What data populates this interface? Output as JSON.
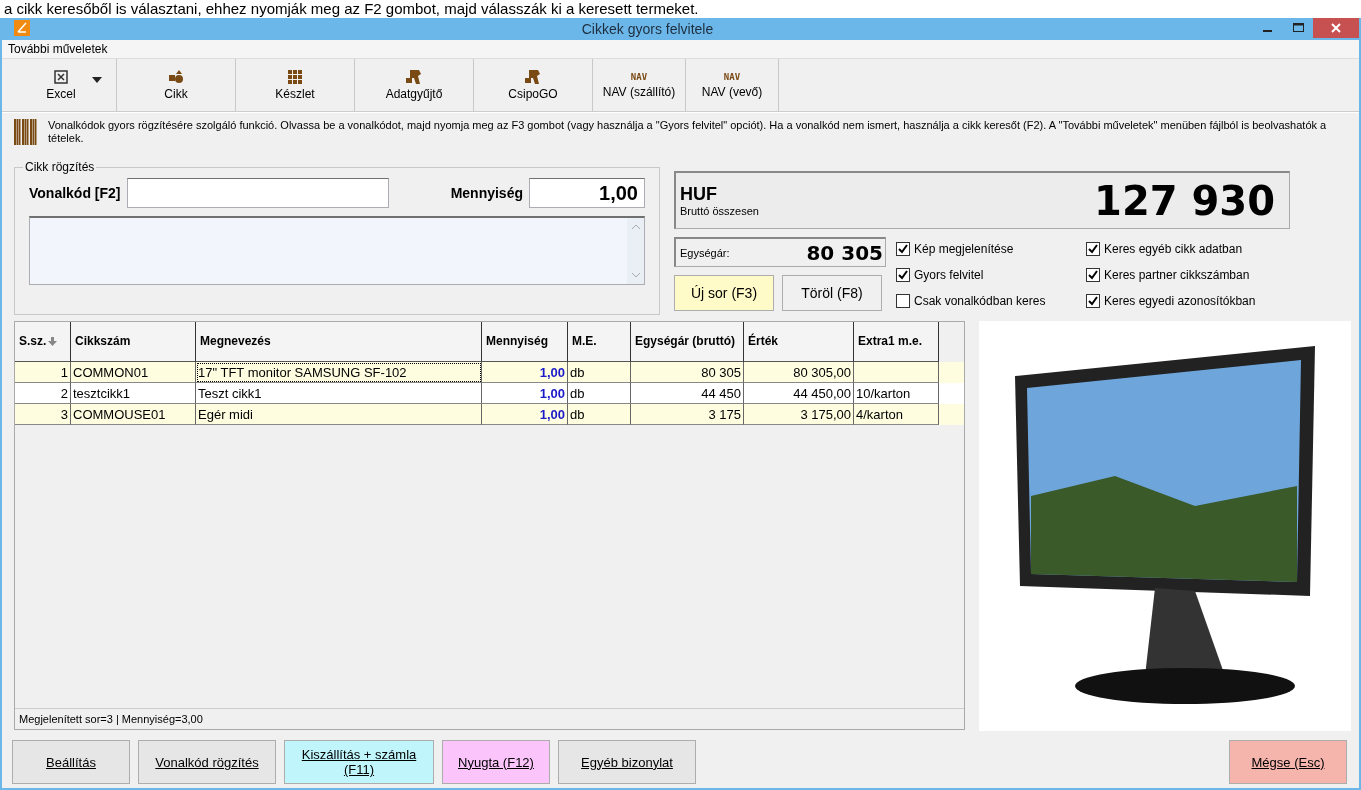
{
  "page_caption": "a cikk keresőből is választani, ehhez nyomják meg az F2 gombot, majd válasszák ki a keresett termeket.",
  "window": {
    "title": "Cikkek gyors felvitele"
  },
  "menu": [
    "További műveletek"
  ],
  "toolbar": [
    {
      "label": "Excel",
      "dropdown": true
    },
    {
      "label": "Cikk",
      "dropdown": false
    },
    {
      "label": "Készlet",
      "dropdown": false
    },
    {
      "label": "Adatgyűjtő",
      "dropdown": false
    },
    {
      "label": "CsipoGO",
      "dropdown": false
    },
    {
      "label": "NAV (szállító)",
      "dropdown": false,
      "icon_text": "NAV"
    },
    {
      "label": "NAV (vevő)",
      "dropdown": false,
      "icon_text": "NAV"
    }
  ],
  "info": "Vonalkódok gyors rögzítésére szolgáló funkció. Olvassa be a vonalkódot, majd nyomja meg az F3 gombot (vagy használja a \"Gyors felvitel\" opciót). Ha a vonalkód nem ismert, használja a cikk keresőt (F2). A \"További műveletek\" menüben fájlból is beolvashatók a tételek.",
  "entry": {
    "title": "Cikk rögzítés",
    "barcode_label": "Vonalkód [F2]",
    "quantity_label": "Mennyiség",
    "quantity": "1,00"
  },
  "summary": {
    "currency": "HUF",
    "caption": "Bruttó összesen",
    "total": "127 930",
    "unit_price_label": "Egységár:",
    "unit_price": "80 305"
  },
  "actions": [
    {
      "label": "Új sor (F3)",
      "color": "#fefbc8"
    },
    {
      "label": "Töröl (F8)",
      "color": "#f0f0f0"
    }
  ],
  "options": [
    {
      "label": "Kép megjelenítése",
      "checked": true
    },
    {
      "label": "Gyors felvitel",
      "checked": true
    },
    {
      "label": "Csak vonalkódban keres",
      "checked": false
    },
    {
      "label": "Keres egyéb cikk adatban",
      "checked": true
    },
    {
      "label": "Keres partner cikkszámban",
      "checked": true
    },
    {
      "label": "Keres egyedi azonosítókban",
      "checked": true
    }
  ],
  "table": {
    "columns": [
      "S.sz.",
      "Cikkszám",
      "Megnevezés",
      "Mennyiség",
      "M.E.",
      "Egységár (bruttó)",
      "Érték",
      "Extra1 m.e."
    ],
    "rows": [
      {
        "selected": true,
        "cells": [
          "1",
          "COMMON01",
          "17\" TFT monitor SAMSUNG SF-102",
          "1,00",
          "db",
          "80 305",
          "80 305,00",
          ""
        ]
      },
      {
        "selected": false,
        "cells": [
          "2",
          "tesztcikk1",
          "Teszt cikk1",
          "1,00",
          "db",
          "44 450",
          "44 450,00",
          "10/karton"
        ]
      },
      {
        "selected": false,
        "cells": [
          "3",
          "COMMOUSE01",
          "Egér midi",
          "1,00",
          "db",
          "3 175",
          "3 175,00",
          "4/karton"
        ]
      }
    ]
  },
  "status_bar": "Megjelenített sor=3 | Mennyiség=3,00",
  "buttons": [
    {
      "label": "Beállítás",
      "color": "#e6e6e6"
    },
    {
      "label": "Vonalkód rögzítés",
      "color": "#e6e6e6"
    },
    {
      "label": "Kiszállítás + számla (F11)",
      "color": "#bff5fb"
    },
    {
      "label": "Nyugta (F12)",
      "color": "#fbc5fb"
    },
    {
      "label": "Egyéb bizonylat",
      "color": "#e6e6e6"
    },
    {
      "label": "Mégse (Esc)",
      "color": "#f5b5ad"
    }
  ]
}
